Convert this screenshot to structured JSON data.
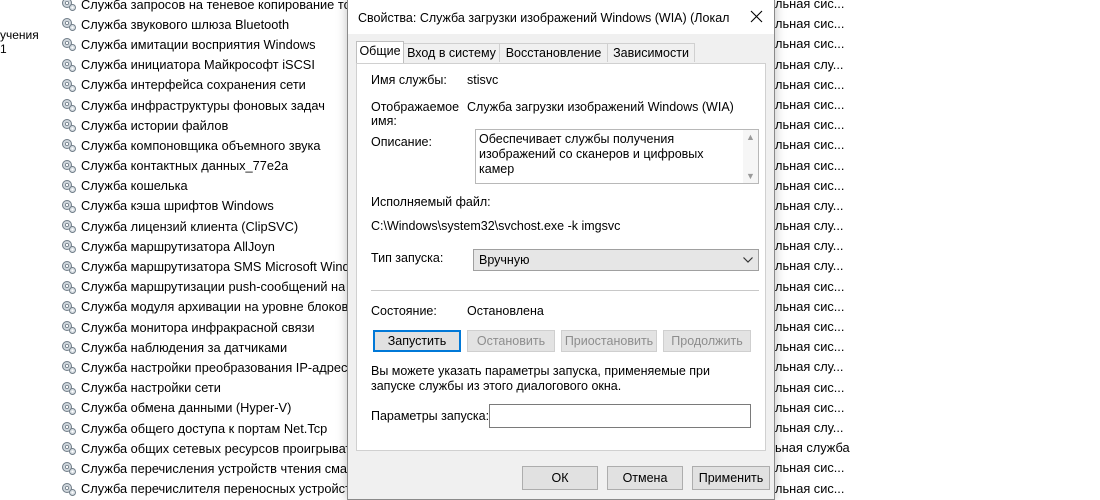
{
  "left_pane": [
    "учения",
    "1"
  ],
  "services": [
    "Служба запросов на теневое копирование то",
    "Служба звукового шлюза Bluetooth",
    "Служба имитации восприятия Windows",
    "Служба инициатора Майкрософт iSCSI",
    "Служба интерфейса сохранения сети",
    "Служба инфраструктуры фоновых задач",
    "Служба истории файлов",
    "Служба компоновщика объемного звука",
    "Служба контактных данных_77e2a",
    "Служба кошелька",
    "Служба кэша шрифтов Windows",
    "Служба лицензий клиента (ClipSVC)",
    "Служба маршрутизатора AllJoyn",
    "Служба маршрутизатора SMS Microsoft Wind",
    "Служба маршрутизации push-сообщений на",
    "Служба модуля архивации на уровне блоков",
    "Служба монитора инфракрасной связи",
    "Служба наблюдения за датчиками",
    "Служба настройки преобразования IP-адресо",
    "Служба настройки сети",
    "Служба обмена данными (Hyper-V)",
    "Служба общего доступа к портам Net.Tcp",
    "Служба общих сетевых ресурсов проигрыват",
    "Служба перечисления устройств чтения смар",
    "Служба перечислителя переносных устройст"
  ],
  "right_column": [
    "льная сис...",
    "льная сис...",
    "льная сис...",
    "льная слу...",
    "льная сис...",
    "льная сис...",
    "льная сис...",
    "льная сис...",
    "льная сис...",
    "льная сис...",
    "льная слу...",
    "льная слу...",
    "льная слу...",
    "льная слу...",
    "льная сис...",
    "льная сис...",
    "льная сис...",
    "льная сис...",
    "льная слу...",
    "льная сис...",
    "льная сис...",
    "льная слу...",
    "ьная служба",
    "льная сис...",
    "льная сис..."
  ],
  "dialog": {
    "title": "Свойства: Служба загрузки изображений Windows (WIA) (Локал",
    "tabs": [
      "Общие",
      "Вход в систему",
      "Восстановление",
      "Зависимости"
    ],
    "service_name_label": "Имя службы:",
    "service_name_value": "stisvc",
    "display_name_label_1": "Отображаемое",
    "display_name_label_2": "имя:",
    "display_name_value": "Служба загрузки изображений Windows (WIA)",
    "description_label": "Описание:",
    "description_value": "Обеспечивает службы получения изображений со сканеров и цифровых камер",
    "executable_label": "Исполняемый файл:",
    "executable_value": "C:\\Windows\\system32\\svchost.exe -k imgsvc",
    "startup_type_label": "Тип запуска:",
    "startup_type_value": "Вручную",
    "status_label": "Состояние:",
    "status_value": "Остановлена",
    "buttons": {
      "start": "Запустить",
      "stop": "Остановить",
      "pause": "Приостановить",
      "resume": "Продолжить"
    },
    "hint": "Вы можете указать параметры запуска, применяемые при запуске службы из этого диалогового окна.",
    "start_params_label": "Параметры запуска:",
    "start_params_value": "",
    "ok": "ОК",
    "cancel": "Отмена",
    "apply": "Применить"
  }
}
